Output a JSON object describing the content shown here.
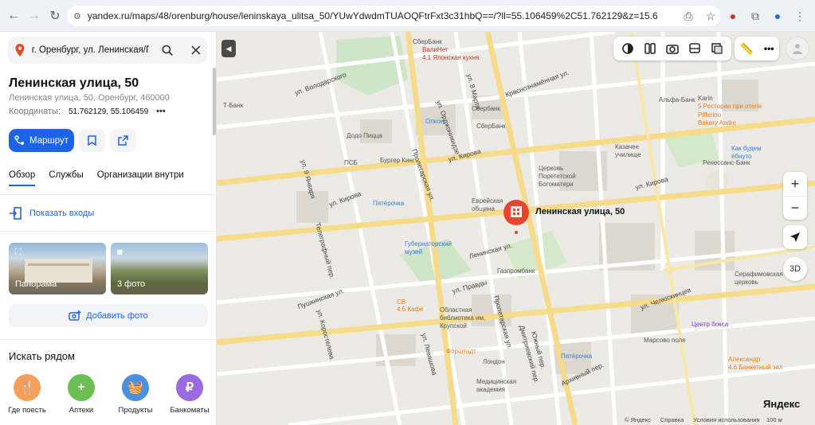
{
  "browser": {
    "url": "yandex.ru/maps/48/orenburg/house/leninskaya_ulitsa_50/YUwYdwdmTUAOQFtrFxt3c31hbQ==/?ll=55.106459%2C51.762129&z=15.6"
  },
  "search": {
    "query": "г. Оренбург, ул. Ленинская/Пушк"
  },
  "place": {
    "title": "Ленинская улица, 50",
    "address": "Ленинская улица, 50, Оренбург, 460000",
    "coords_label": "Координаты:",
    "coords_value": "51.762129, 55.106459"
  },
  "actions": {
    "route_label": "Маршрут"
  },
  "tabs": [
    {
      "label": "Обзор"
    },
    {
      "label": "Службы"
    },
    {
      "label": "Организации внутри"
    }
  ],
  "entrances_label": "Показать входы",
  "photos": [
    {
      "label": "Панорама"
    },
    {
      "label": "3 фото"
    }
  ],
  "add_photo_label": "Добавить фото",
  "nearby": {
    "title": "Искать рядом",
    "items": [
      {
        "label": "Где поесть",
        "color": "#f5a05a"
      },
      {
        "label": "Аптеки",
        "color": "#6bbf55"
      },
      {
        "label": "Продукты",
        "color": "#4a8fe0"
      },
      {
        "label": "Банкоматы",
        "color": "#9b6ae0"
      }
    ]
  },
  "map": {
    "pin_label": "Ленинская улица, 50",
    "zoom_in": "+",
    "zoom_out": "−",
    "btn_3d": "3D",
    "logo": "Яндекс",
    "footer": [
      "© Яндекс",
      "Справка",
      "Условия использования"
    ],
    "scale": "100 м",
    "streets": [
      "ул. Володарского",
      "ул. 8 Марта",
      "ул. Орджоникидзе",
      "Краснознамённая ул.",
      "ул. Кирова",
      "Пролетарская ул.",
      "ул. 9 Января",
      "ул. Кирова",
      "Телеграфный пер.",
      "Пушкинская ул.",
      "ул. Правды",
      "Ленинская ул.",
      "ул. Челюскинцев",
      "ул. Коростелева",
      "ул. Левашова",
      "Пролетарская ул.",
      "Дмитриевский пер.",
      "Южный пер.",
      "Архивный пер.",
      "ул. Кирова"
    ],
    "pois": [
      "СберБанк",
      "ВалиНет",
      "4.1 Японская кухня",
      "Т-Банк",
      "Сбербанк",
      "Олкон",
      "Додо Пицца",
      "СберБанк",
      "ПСБ",
      "Бургер Кинг",
      "Еврейская община",
      "Церковь Порететской Богоматери",
      "Пятёрочка",
      "Губернаторский музей",
      "Газпромбанк",
      "СВ",
      "4.5 Кафе",
      "Областная библиотека им. Крупской",
      "Пятёрочка",
      "Форштадт",
      "Лондон",
      "Медицинская академия",
      "Альфа-Банк",
      "Karin",
      "5 Ресторан при отеле",
      "Pifferino Bakery Andre",
      "Казачее училище",
      "Как будем ёбнуто",
      "Ренессанс-Банк",
      "Центр бокса",
      "Марсово поле",
      "Серафимовская церковь",
      "Александр",
      "4.6 Банкетный зал"
    ]
  }
}
